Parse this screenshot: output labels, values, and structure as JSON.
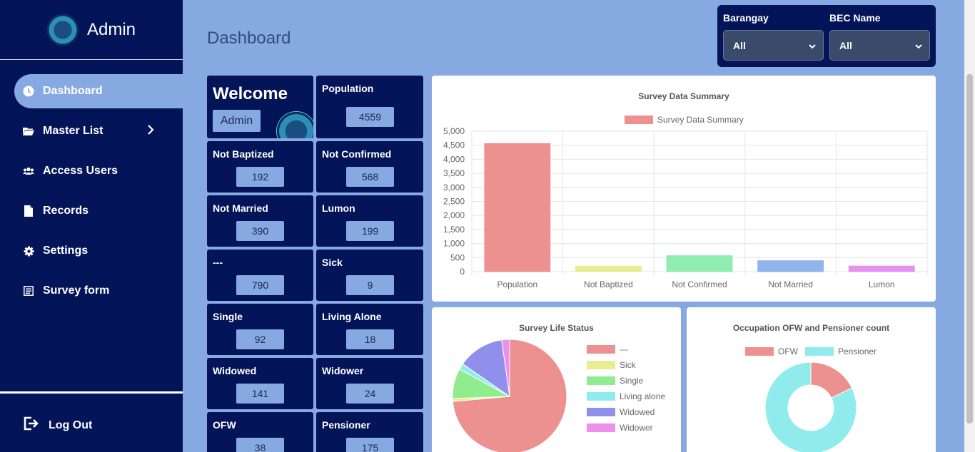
{
  "sidebar": {
    "title": "Admin",
    "items": [
      {
        "label": "Dashboard",
        "icon": "clock-icon"
      },
      {
        "label": "Master List",
        "icon": "folder-icon"
      },
      {
        "label": "Access Users",
        "icon": "users-icon"
      },
      {
        "label": "Records",
        "icon": "file-icon"
      },
      {
        "label": "Settings",
        "icon": "gear-icon"
      },
      {
        "label": "Survey form",
        "icon": "form-icon"
      }
    ],
    "logout": "Log Out"
  },
  "header": {
    "title": "Dashboard"
  },
  "filters": {
    "barangay": {
      "label": "Barangay",
      "value": "All"
    },
    "bec": {
      "label": "BEC Name",
      "value": "All"
    }
  },
  "welcome": {
    "title": "Welcome",
    "user": "Admin"
  },
  "stats": [
    {
      "label": "Population",
      "value": "4559"
    },
    {
      "label": "Not Baptized",
      "value": "192"
    },
    {
      "label": "Not Confirmed",
      "value": "568"
    },
    {
      "label": "Not Married",
      "value": "390"
    },
    {
      "label": "Lumon",
      "value": "199"
    },
    {
      "label": "---",
      "value": "790"
    },
    {
      "label": "Sick",
      "value": "9"
    },
    {
      "label": "Single",
      "value": "92"
    },
    {
      "label": "Living Alone",
      "value": "18"
    },
    {
      "label": "Widowed",
      "value": "141"
    },
    {
      "label": "Widower",
      "value": "24"
    },
    {
      "label": "OFW",
      "value": "38"
    },
    {
      "label": "Pensioner",
      "value": "175"
    }
  ],
  "colors": {
    "navy": "#031459",
    "accent": "#87a9e1"
  },
  "chart_data": [
    {
      "type": "bar",
      "title": "Survey Data Summary",
      "legend": "Survey Data Summary",
      "categories": [
        "Population",
        "Not Baptized",
        "Not Confirmed",
        "Not Married",
        "Lumon"
      ],
      "values": [
        4559,
        192,
        568,
        390,
        199
      ],
      "colors": [
        "#ec9090",
        "#e9ec90",
        "#90ecb0",
        "#90b4ec",
        "#e490ec"
      ],
      "ylim": [
        0,
        5000
      ],
      "yticks": [
        "5,000",
        "4,500",
        "4,000",
        "3,500",
        "3,000",
        "2,500",
        "2,000",
        "1,500",
        "1,000",
        "500",
        "0"
      ],
      "grid": true
    },
    {
      "type": "pie",
      "title": "Survey Life Status",
      "labels": [
        "---",
        "Sick",
        "Single",
        "Living alone",
        "Widowed",
        "Widower"
      ],
      "values": [
        790,
        9,
        92,
        18,
        141,
        24
      ],
      "colors": [
        "#ec9090",
        "#e9ec90",
        "#90ec8f",
        "#90ecec",
        "#9090ec",
        "#ec90ec"
      ],
      "legend_position": "right"
    },
    {
      "type": "pie",
      "title": "Occupation OFW and Pensioner count",
      "labels": [
        "OFW",
        "Pensioner"
      ],
      "values": [
        38,
        175
      ],
      "colors": [
        "#ec9090",
        "#90ecec"
      ],
      "legend_position": "top"
    }
  ]
}
